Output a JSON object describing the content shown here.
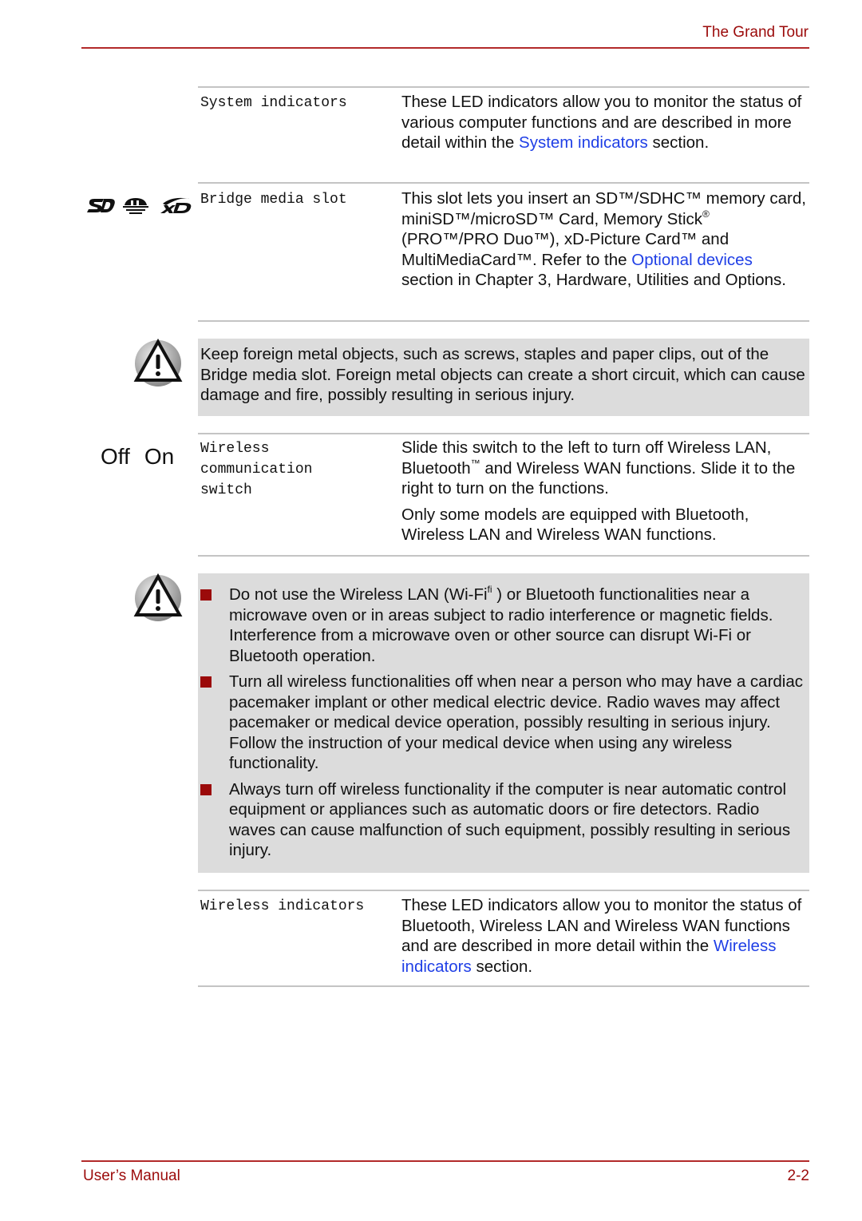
{
  "header": {
    "title": "The Grand Tour"
  },
  "footer": {
    "left": "User’s Manual",
    "page_number": "2-2"
  },
  "colors": {
    "brand_red": "#9b0a0a",
    "link_blue": "#1f3fe6",
    "note_background": "#dcdcdc",
    "rule_gray": "#c4c4c4"
  },
  "entries": {
    "system_indicators": {
      "term": "System indicators",
      "text_before": "These LED indicators allow you to monitor the status of various computer functions and are described in more detail within the ",
      "link": "System indicators",
      "text_after": " section."
    },
    "bridge_media_slot": {
      "icons": [
        "sd-card-logo-icon",
        "memory-stick-logo-icon",
        "xd-picture-card-logo-icon"
      ],
      "term": "Bridge media slot",
      "text_before": "This slot lets you insert an SD™/SDHC™ memory card, miniSD™/microSD™ Card, Memory Stick",
      "reg_mark": "®",
      "text_middle": " (PRO™/PRO Duo™), xD-Picture Card™ and MultiMediaCard™. Refer to the ",
      "link": "Optional devices",
      "text_after": " section in Chapter 3, Hardware, Utilities and Options."
    },
    "bridge_warning": {
      "icon": "warning-icon",
      "text": "Keep foreign metal objects, such as screws, staples and paper clips, out of the Bridge media slot. Foreign metal objects can create a short circuit, which can cause damage and fire, possibly resulting in serious injury."
    },
    "wireless_switch": {
      "switch_off_label": "Off",
      "switch_on_label": "On",
      "term_lines": [
        "Wireless",
        "communication",
        "switch"
      ],
      "para1_before": "Slide this switch to the left to turn off Wireless LAN, Bluetooth",
      "para1_tm": "™",
      "para1_after": " and Wireless WAN functions. Slide it to the right to turn on the functions.",
      "para2": "Only some models are equipped with Bluetooth, Wireless LAN and Wireless WAN functions."
    },
    "wireless_warning": {
      "icon": "warning-icon",
      "bullets": [
        {
          "before": "Do not use the Wireless LAN (Wi-Fi",
          "sup": "fi",
          "after": " ) or Bluetooth functionalities near a microwave oven or in areas subject to radio interference or magnetic fields. Interference from a microwave oven or other source can disrupt Wi-Fi or Bluetooth operation."
        },
        {
          "text": "Turn all wireless functionalities off when near a person who may have a cardiac pacemaker implant or other medical electric device. Radio waves may affect pacemaker or medical device operation, possibly resulting in serious injury. Follow the instruction of your medical device when using any wireless functionality."
        },
        {
          "text": "Always turn off wireless functionality if the computer is near automatic control equipment or appliances such as automatic doors or fire detectors. Radio waves can cause malfunction of such equipment, possibly resulting in serious injury."
        }
      ]
    },
    "wireless_indicators": {
      "term": "Wireless indicators",
      "text_before": "These LED indicators allow you to monitor the status of Bluetooth, Wireless LAN and Wireless WAN functions and are described in more detail within the ",
      "link": "Wireless indicators",
      "text_after": " section."
    }
  }
}
